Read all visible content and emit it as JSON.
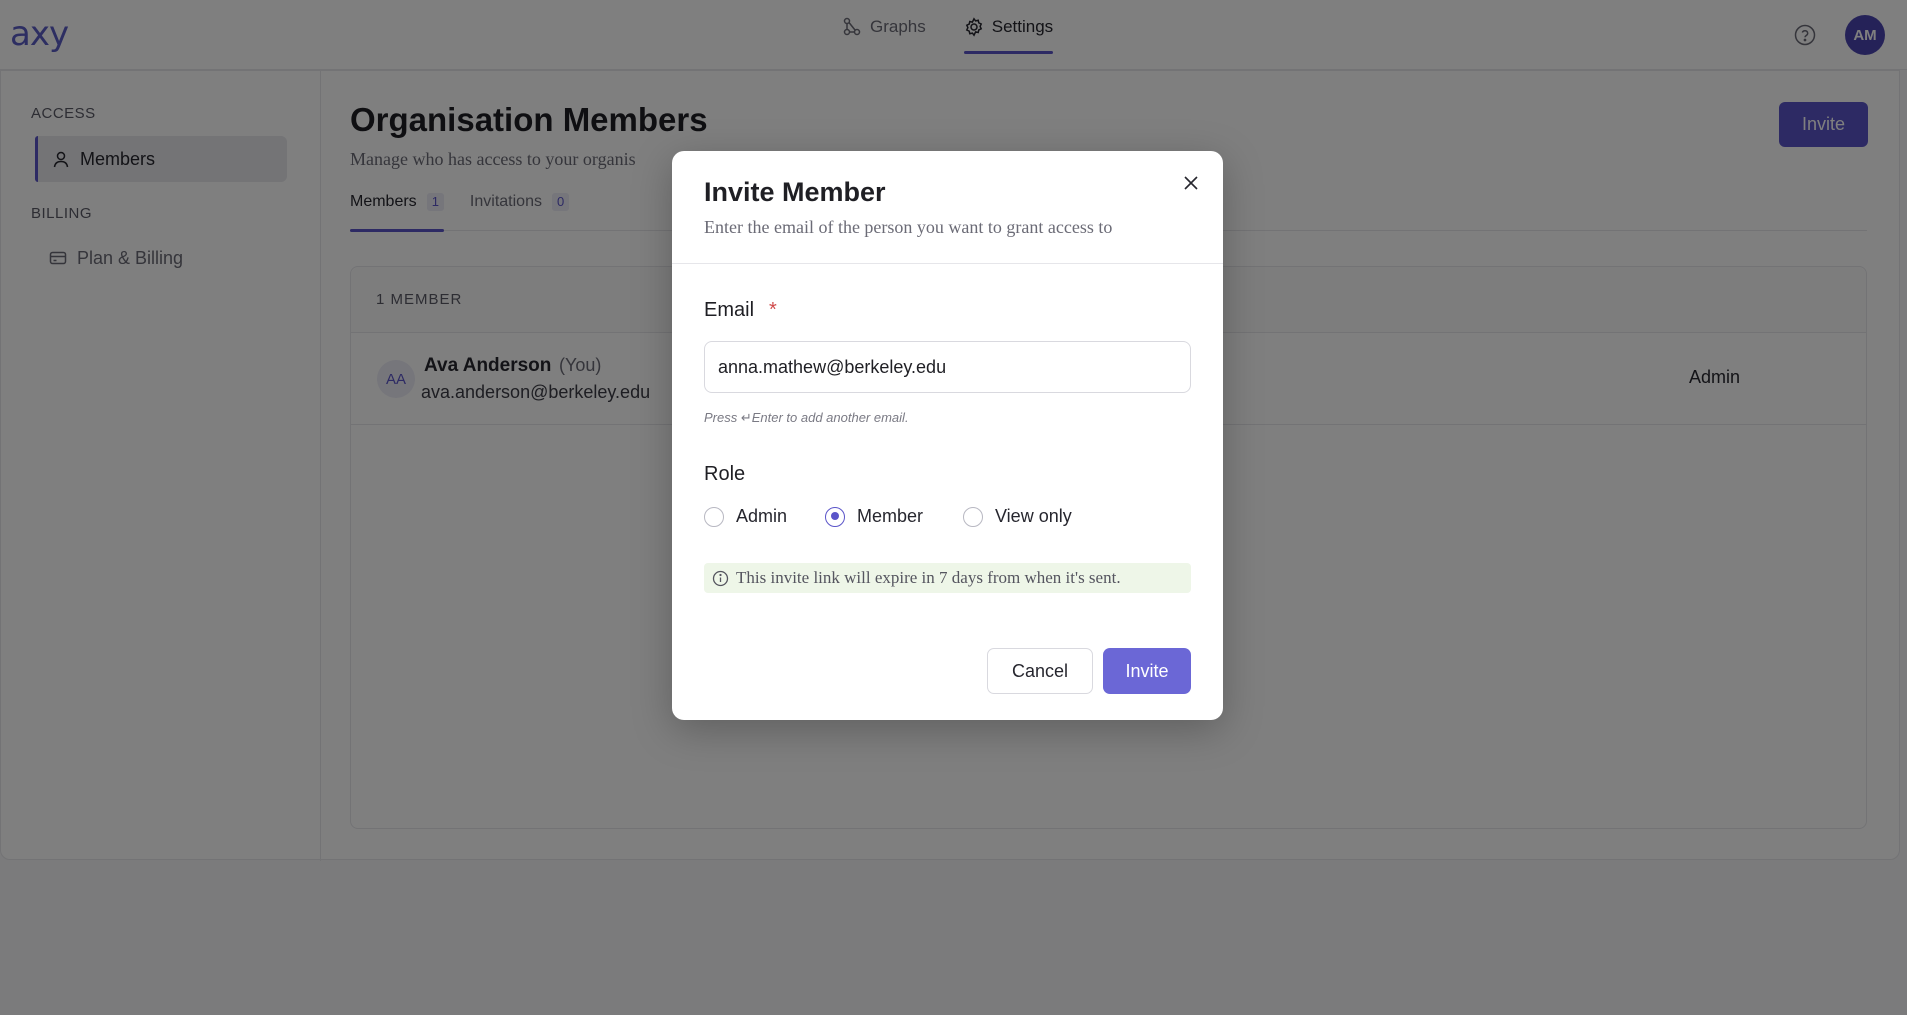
{
  "app": {
    "logo_text": "axy"
  },
  "nav": {
    "items": [
      {
        "label": "Graphs",
        "icon": "graph-icon",
        "active": false
      },
      {
        "label": "Settings",
        "icon": "gear-icon",
        "active": true
      }
    ],
    "avatar_initials": "AM"
  },
  "sidebar": {
    "sections": [
      {
        "heading": "ACCESS",
        "items": [
          {
            "label": "Members",
            "icon": "person-icon",
            "active": true
          }
        ]
      },
      {
        "heading": "BILLING",
        "items": [
          {
            "label": "Plan & Billing",
            "icon": "card-icon",
            "active": false
          }
        ]
      }
    ]
  },
  "page": {
    "title": "Organisation Members",
    "subtitle": "Manage who has access to your organis",
    "invite_label": "Invite",
    "tabs": [
      {
        "label": "Members",
        "count": "1",
        "active": true
      },
      {
        "label": "Invitations",
        "count": "0",
        "active": false
      }
    ],
    "table": {
      "header": "1 MEMBER",
      "rows": [
        {
          "initials": "AA",
          "name": "Ava Anderson",
          "you": "(You)",
          "email": "ava.anderson@berkeley.edu",
          "role": "Admin"
        }
      ]
    }
  },
  "modal": {
    "title": "Invite Member",
    "subtitle": "Enter the email of the person you want to grant access to",
    "email_label": "Email",
    "required_mark": "*",
    "email_value": "anna.mathew@berkeley.edu",
    "hint": "Press ↵Enter to add another email.",
    "role_label": "Role",
    "roles": [
      {
        "label": "Admin",
        "checked": false
      },
      {
        "label": "Member",
        "checked": true
      },
      {
        "label": "View only",
        "checked": false
      }
    ],
    "info": "This invite link will expire in 7 days from when it's sent.",
    "cancel_label": "Cancel",
    "invite_label": "Invite"
  },
  "colors": {
    "accent": "#5b55c9",
    "button": "#6b67d6",
    "info_bg": "#eef6e8"
  }
}
